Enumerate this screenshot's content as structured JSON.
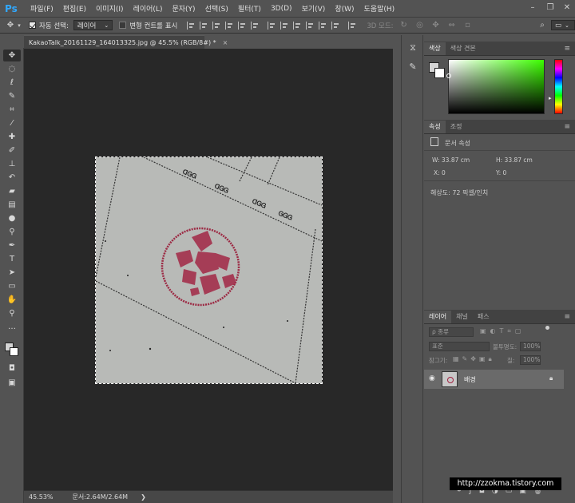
{
  "app": {
    "logo": "Ps"
  },
  "menu": [
    "파일(F)",
    "편집(E)",
    "이미지(I)",
    "레이어(L)",
    "문자(Y)",
    "선택(S)",
    "필터(T)",
    "3D(D)",
    "보기(V)",
    "창(W)",
    "도움말(H)"
  ],
  "window_controls": [
    "minimize-icon",
    "restore-icon",
    "close-icon"
  ],
  "options": {
    "auto_select_label": "자동 선택:",
    "auto_select_checked": true,
    "auto_select_value": "레이어",
    "transform_label": "변형 컨트롤 표시",
    "transform_checked": false,
    "mode_3d_label": "3D 모드:"
  },
  "document": {
    "tab_title": "KakaoTalk_20161129_164013325.jpg @ 45.5% (RGB/8#) *",
    "close": "×"
  },
  "status": {
    "zoom": "45.53%",
    "doc_info": "문서:2.64M/2.64M",
    "arrow": "❯"
  },
  "color_panel": {
    "tabs": [
      "색상",
      "색상 견본"
    ],
    "fg_color": "#d4d4d4",
    "bg_color": "#ffffff",
    "spectrum_accent": "#3cff00"
  },
  "properties_panel": {
    "tabs": [
      "속성",
      "조정"
    ],
    "doc_props_label": "문서 속성",
    "w": "W: 33.87 cm",
    "h": "H: 33.87 cm",
    "x": "X: 0",
    "y": "Y: 0",
    "resolution": "해상도: 72 픽셀/인치"
  },
  "layers_panel": {
    "tabs": [
      "레이어",
      "채널",
      "패스"
    ],
    "kind_filter": "ρ 종류",
    "blend_mode": "표준",
    "opacity_label": "불투명도:",
    "opacity_value": "100%",
    "lock_label": "잠그기:",
    "fill_label": "칠:",
    "fill_value": "100%",
    "layer_name": "배경"
  },
  "watermark": "http://zzokma.tistory.com"
}
